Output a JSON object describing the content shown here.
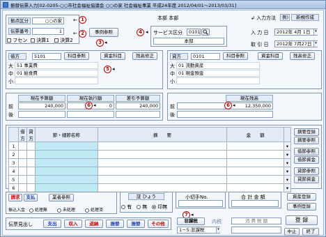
{
  "window": {
    "title": "振替伝票入力[02-0205-○○市社会福祉協議会 ○○の家 社会福祉事業 平成24年度 2012/04/01～2013/03/31]"
  },
  "header": {
    "facility_label": "拠点区分",
    "facility_value": "○○の家",
    "slip_no_label": "伝票番号",
    "slip_no_value": "1",
    "fusen_label": "フセン",
    "kessan1_label": "決算1",
    "kessan2_label": "決算2",
    "jirei_button": "事例参照",
    "dept_top": "本部 本部",
    "service_label": "サービス区分",
    "service_code": "0101",
    "service_name": "本部",
    "input_method_label": "入力方法",
    "example_label": "例)",
    "new_create_label": "新規作成",
    "entry_date_label": "入 力 日",
    "entry_date_value": "2012年 4月 1日",
    "trans_date_label": "取 引 日",
    "trans_date_value": "2012年 7月27日"
  },
  "debit": {
    "title": "借方",
    "code": "5101",
    "kamoku_ref": "科目参照",
    "shikin_btn": "資金科目",
    "zandaka_btn": "残高修正",
    "dai_label": "大",
    "dai_value": "51 事業費",
    "chu_label": "中",
    "chu_value": "01 給食費",
    "sho_label": "小",
    "sho_value": ""
  },
  "credit": {
    "title": "貸方",
    "code": "0101",
    "kamoku_ref": "科目参照",
    "shikin_btn": "資金科目",
    "zandaka_btn": "残高修正",
    "dai_label": "大",
    "dai_value": "01 流動資産",
    "chu_label": "中",
    "chu_value": "01 現金預金",
    "sho_label": "小",
    "sho_value": ""
  },
  "budget": {
    "col1": "現在予算額",
    "col2": "現在執行額",
    "col3": "差引予算額",
    "row_mae": "前",
    "row_ato": "後",
    "mae_values": [
      "240,000",
      "0",
      "240,000"
    ],
    "ato_values": [
      "",
      "",
      ""
    ]
  },
  "balance": {
    "col": "現在残高",
    "row_mae": "前",
    "row_ato": "後",
    "mae_value": "12,350,000",
    "ato_value": ""
  },
  "detail": {
    "headers": [
      "借方",
      "貸方",
      "節・細節名称",
      "摘　　要",
      "金　　額"
    ],
    "row_numbers": [
      "1",
      "2",
      "3",
      "4",
      "5",
      "6"
    ]
  },
  "side_buttons": [
    "摘要登録",
    "摘要参照",
    "借節参照",
    "借節資金",
    "貸節参照",
    "貸節資金"
  ],
  "bottom": {
    "seikyu": "請求",
    "shiharai": "支払",
    "gyosha_ref": "業者参照",
    "process_label": "振込入金",
    "process_opts": [
      "処理無",
      "未処理",
      "処理済"
    ],
    "shoshohyo_label": "証 ひょう",
    "shoshohyo_opts": [
      "有",
      "無",
      "印無"
    ],
    "kogitte_label": "小切手No.",
    "total_label": "合 計 金 額",
    "shiryo_btn": "資産登録",
    "jirei_toroku_btn": "事例登録",
    "tax_type_btn": "非課税",
    "uchizei_label": "内税",
    "consume_tax_label": "消 費 税 額",
    "tax_select": "1－5:非課税",
    "denpyo_midashi": "伝票見出し",
    "midashi_buttons": [
      "支出",
      "収入",
      "返納",
      "振替",
      "振替",
      "その他"
    ],
    "register_btn": "登 録",
    "stop_btn": "中止",
    "end_btn": "終了"
  },
  "markers": [
    "1",
    "2",
    "3",
    "4",
    "5",
    "6",
    "6",
    "7"
  ]
}
